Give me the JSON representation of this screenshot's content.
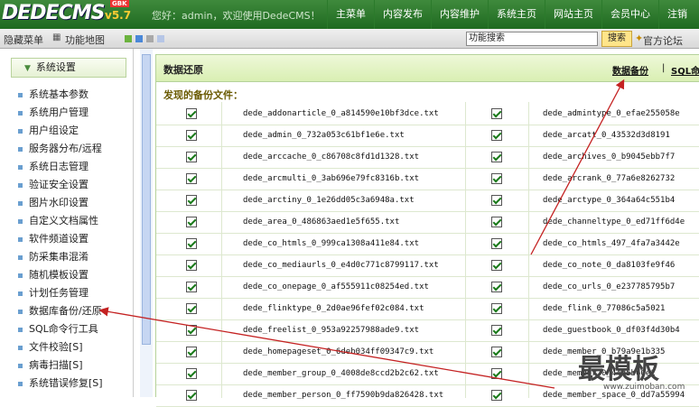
{
  "app": {
    "logo_text": "DEDECMS",
    "version": "v5.7",
    "badge": "GBK",
    "welcome": "您好：admin，欢迎使用DedeCMS！"
  },
  "top_nav": [
    "主菜单",
    "内容发布",
    "内容维护",
    "系统主页",
    "网站主页",
    "会员中心",
    "注销"
  ],
  "sub_bar": {
    "hide_menu": "隐藏菜单",
    "function_map": "功能地图",
    "search_value": "功能搜索",
    "search_button": "搜索",
    "forum": "官方论坛"
  },
  "sidebar": {
    "header": "系统设置",
    "items": [
      "系统基本参数",
      "系统用户管理",
      "用户组设定",
      "服务器分布/远程",
      "系统日志管理",
      "验证安全设置",
      "图片水印设置",
      "自定义文档属性",
      "软件频道设置",
      "防采集串混淆",
      "随机模板设置",
      "计划任务管理",
      "数据库备份/还原",
      "SQL命令行工具",
      "文件校验[S]",
      "病毒扫描[S]",
      "系统错误修复[S]"
    ]
  },
  "main": {
    "title": "数据还原",
    "link_backup": "数据备份",
    "separator": "|",
    "link_sql": "SQL命令",
    "found_label": "发现的备份文件：",
    "rows": [
      [
        "dede_addonarticle_0_a814590e10bf3dce.txt",
        "dede_admintype_0_efae255058e"
      ],
      [
        "dede_admin_0_732a053c61bf1e6e.txt",
        "dede_arcatt_0_43532d3d8191"
      ],
      [
        "dede_arccache_0_c86708c8fd1d1328.txt",
        "dede_archives_0_b9045ebb7f7"
      ],
      [
        "dede_arcmulti_0_3ab696e79fc8316b.txt",
        "dede_arcrank_0_77a6e8262732"
      ],
      [
        "dede_arctiny_0_1e26dd05c3a6948a.txt",
        "dede_arctype_0_364a64c551b4"
      ],
      [
        "dede_area_0_486863aed1e5f655.txt",
        "dede_channeltype_0_ed71ff6d4e"
      ],
      [
        "dede_co_htmls_0_999ca1308a411e84.txt",
        "dede_co_htmls_497_4fa7a3442e"
      ],
      [
        "dede_co_mediaurls_0_e4d0c771c8799117.txt",
        "dede_co_note_0_da8103fe9f46"
      ],
      [
        "dede_co_onepage_0_af555911c08254ed.txt",
        "dede_co_urls_0_e237785795b7"
      ],
      [
        "dede_flinktype_0_2d0ae96fef02c084.txt",
        "dede_flink_0_77086c5a5021"
      ],
      [
        "dede_freelist_0_953a92257988ade9.txt",
        "dede_guestbook_0_df03f4d30b4"
      ],
      [
        "dede_homepageset_0_6deb034ff09347c9.txt",
        "dede_member_0_b79a9e1b335"
      ],
      [
        "dede_member_group_0_4008de8ccd2b2c62.txt",
        "dede_member_0_44d5b60e1"
      ],
      [
        "dede_member_person_0_ff7590b9da826428.txt",
        "dede_member_space_0_dd7a55994"
      ]
    ]
  },
  "watermark": {
    "big": "最模板",
    "small": "www.zuimoban.com"
  },
  "colors": {
    "top_bar": "#2a7a2a",
    "main_header": "#e3f3c5",
    "found_label": "#6a5a00",
    "arrow": "#c42222"
  }
}
